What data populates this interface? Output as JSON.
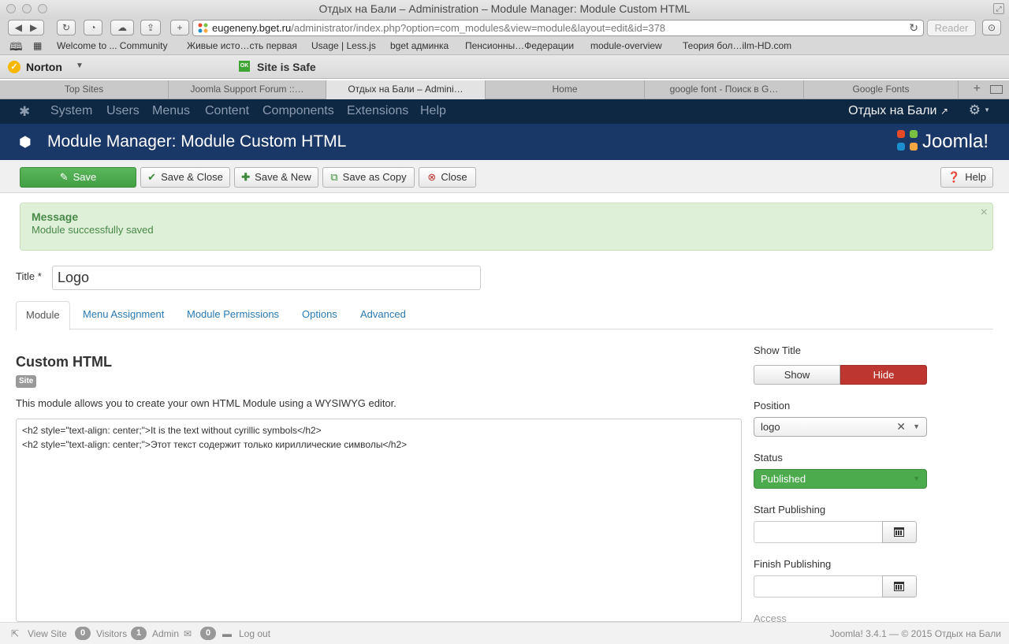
{
  "window": {
    "title": "Отдых на Бали – Administration – Module Manager: Module Custom HTML"
  },
  "browser": {
    "url_host": "eugeneny.bget.ru",
    "url_path": "/administrator/index.php?option=com_modules&view=module&layout=edit&id=378",
    "reader_label": "Reader",
    "bookmarks": [
      "Welcome to ... Community",
      "Живые исто…сть первая",
      "Usage | Less.js",
      "bget админка",
      "Пенсионны…Федерации",
      "module-overview",
      "Теория бол…ilm-HD.com"
    ],
    "norton": {
      "name": "Norton",
      "ok_badge": "OK",
      "safe_text": "Site is Safe"
    },
    "tabs": [
      "Top Sites",
      "Joomla Support Forum ::…",
      "Отдых на Бали – Admini…",
      "Home",
      "google font - Поиск в G…",
      "Google Fonts"
    ],
    "active_tab_index": 2
  },
  "admin_nav": {
    "items": [
      "System",
      "Users",
      "Menus",
      "Content",
      "Components",
      "Extensions",
      "Help"
    ],
    "site_link": "Отдых на Бали"
  },
  "header": {
    "title": "Module Manager: Module Custom HTML",
    "logo_text": "Joomla!"
  },
  "toolbar": {
    "save": "Save",
    "save_close": "Save & Close",
    "save_new": "Save & New",
    "save_copy": "Save as Copy",
    "close": "Close",
    "help": "Help"
  },
  "alert": {
    "heading": "Message",
    "message": "Module successfully saved"
  },
  "form": {
    "title_label": "Title *",
    "title_value": "Logo",
    "tabs": [
      "Module",
      "Menu Assignment",
      "Module Permissions",
      "Options",
      "Advanced"
    ],
    "active_tab_index": 0
  },
  "module": {
    "heading": "Custom HTML",
    "badge": "Site",
    "description": "This module allows you to create your own HTML Module using a WYSIWYG editor.",
    "editor_lines": [
      "<h2 style=\"text-align: center;\">It is the text without cyrillic symbols</h2>",
      "<h2 style=\"text-align: center;\">Этот текст содержит только кириллические символы</h2>"
    ]
  },
  "sidebar": {
    "show_title_label": "Show Title",
    "show_option": "Show",
    "hide_option": "Hide",
    "selected_show_title": "Hide",
    "position_label": "Position",
    "position_value": "logo",
    "status_label": "Status",
    "status_value": "Published",
    "start_publishing_label": "Start Publishing",
    "start_publishing_value": "",
    "finish_publishing_label": "Finish Publishing",
    "finish_publishing_value": "",
    "access_label": "Access"
  },
  "footer": {
    "view_site": "View Site",
    "visitors_count": "0",
    "visitors_label": "Visitors",
    "admin_count": "1",
    "admin_label": "Admin",
    "messages_count": "0",
    "logout": "Log out",
    "version": "Joomla! 3.4.1  —  © 2015 Отдых на Бали"
  },
  "colors": {
    "admin_nav_bg": "#0e2743",
    "header_bg": "#1a3867",
    "success": "#5bb75b",
    "danger": "#bd362f",
    "link": "#2a7ab3",
    "alert_bg": "#dff0d8"
  }
}
